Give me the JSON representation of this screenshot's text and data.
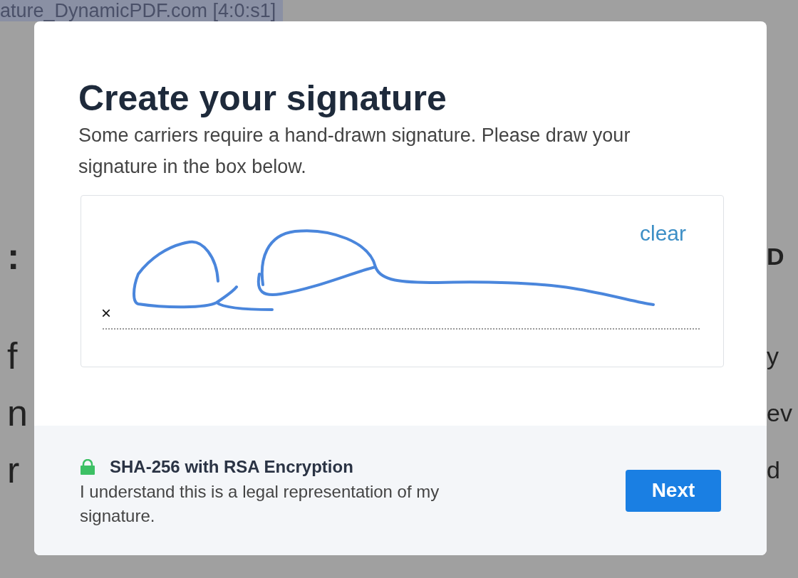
{
  "background": {
    "highlighted_text": "ature_DynamicPDF.com [4:0:s1]",
    "rows": [
      {
        "left": ":",
        "right": "D"
      },
      {
        "left": "f",
        "right": "y"
      },
      {
        "left": "n",
        "right": "ev"
      },
      {
        "left": "r",
        "right": "d"
      }
    ]
  },
  "dialog": {
    "title": "Create your signature",
    "description": "Some carriers require a hand-drawn signature. Please draw your signature in the box below.",
    "signature_pad": {
      "clear": "clear",
      "sign_mark": "×"
    },
    "footer": {
      "security": "SHA-256 with RSA Encryption",
      "note": "I understand this is a legal representation of my signature.",
      "button": "Next"
    }
  }
}
